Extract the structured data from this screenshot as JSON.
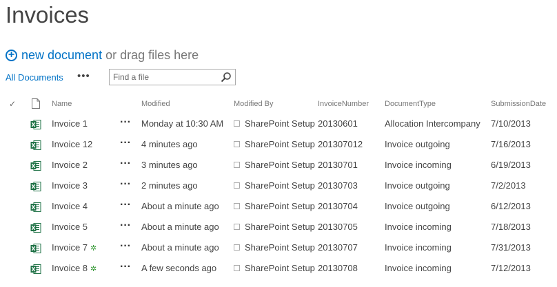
{
  "page": {
    "title": "Invoices"
  },
  "toolbar": {
    "new_document": "new document",
    "drag_text": "or drag files here"
  },
  "views": {
    "all_documents": "All Documents",
    "more": "•••"
  },
  "search": {
    "placeholder": "Find a file"
  },
  "columns": {
    "name": "Name",
    "modified": "Modified",
    "modified_by": "Modified By",
    "invoice_number": "InvoiceNumber",
    "document_type": "DocumentType",
    "submission_date": "SubmissionDate"
  },
  "rows": [
    {
      "name": "Invoice 1",
      "modified": "Monday at 10:30 AM",
      "modified_by": "SharePoint Setup",
      "invoice_number": "20130601",
      "document_type": "Allocation Intercompany",
      "submission_date": "7/10/2013",
      "is_new": false
    },
    {
      "name": "Invoice 12",
      "modified": "4 minutes ago",
      "modified_by": "SharePoint Setup",
      "invoice_number": "201307012",
      "document_type": "Invoice outgoing",
      "submission_date": "7/16/2013",
      "is_new": false
    },
    {
      "name": "Invoice 2",
      "modified": "3 minutes ago",
      "modified_by": "SharePoint Setup",
      "invoice_number": "20130701",
      "document_type": "Invoice incoming",
      "submission_date": "6/19/2013",
      "is_new": false
    },
    {
      "name": "Invoice 3",
      "modified": "2 minutes ago",
      "modified_by": "SharePoint Setup",
      "invoice_number": "20130703",
      "document_type": "Invoice outgoing",
      "submission_date": "7/2/2013",
      "is_new": false
    },
    {
      "name": "Invoice 4",
      "modified": "About a minute ago",
      "modified_by": "SharePoint Setup",
      "invoice_number": "20130704",
      "document_type": "Invoice outgoing",
      "submission_date": "6/12/2013",
      "is_new": false
    },
    {
      "name": "Invoice 5",
      "modified": "About a minute ago",
      "modified_by": "SharePoint Setup",
      "invoice_number": "20130705",
      "document_type": "Invoice incoming",
      "submission_date": "7/18/2013",
      "is_new": false
    },
    {
      "name": "Invoice 7",
      "modified": "About a minute ago",
      "modified_by": "SharePoint Setup",
      "invoice_number": "20130707",
      "document_type": "Invoice incoming",
      "submission_date": "7/31/2013",
      "is_new": true
    },
    {
      "name": "Invoice 8",
      "modified": "A few seconds ago",
      "modified_by": "SharePoint Setup",
      "invoice_number": "20130708",
      "document_type": "Invoice incoming",
      "submission_date": "7/12/2013",
      "is_new": true
    }
  ],
  "icons": {
    "add": "plus-circle-icon",
    "search": "magnifier-icon",
    "select_all": "checkmark-icon",
    "doc_type": "document-icon",
    "file": "excel-file-icon",
    "new": "new-item-icon"
  },
  "colors": {
    "accent": "#0072c6",
    "excel": "#1e7145",
    "new_marker": "#3a9a3a"
  }
}
